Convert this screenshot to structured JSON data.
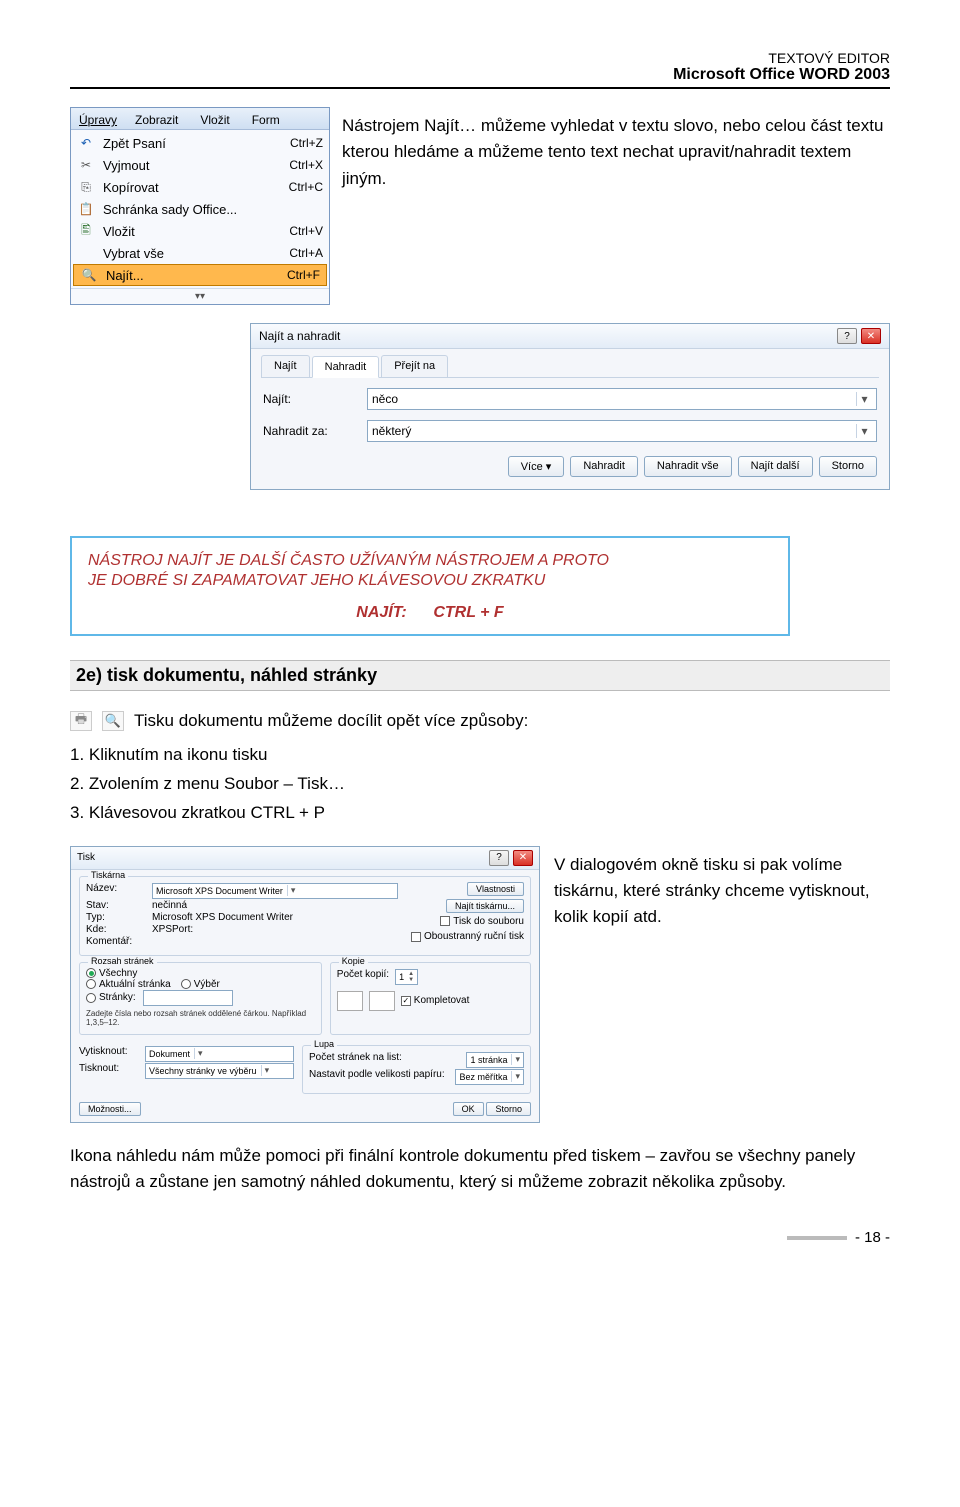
{
  "header": {
    "line1": "TEXTOVÝ EDITOR",
    "line2": "Microsoft Office WORD 2003"
  },
  "menu": {
    "tabs": [
      "Úpravy",
      "Zobrazit",
      "Vložit",
      "Form"
    ],
    "items": [
      {
        "icon": "↶",
        "iconClass": "icon-arrow",
        "label": "Zpět Psaní",
        "shortcut": "Ctrl+Z"
      },
      {
        "icon": "✂",
        "iconClass": "icon-scissors",
        "label": "Vyjmout",
        "shortcut": "Ctrl+X"
      },
      {
        "icon": "⎘",
        "iconClass": "icon-copy",
        "label": "Kopírovat",
        "shortcut": "Ctrl+C"
      },
      {
        "icon": "📋",
        "iconClass": "icon-clip",
        "label": "Schránka sady Office...",
        "shortcut": ""
      },
      {
        "icon": "🖺",
        "iconClass": "icon-paste",
        "label": "Vložit",
        "shortcut": "Ctrl+V"
      },
      {
        "icon": "",
        "iconClass": "",
        "label": "Vybrat vše",
        "shortcut": "Ctrl+A"
      },
      {
        "icon": "🔍",
        "iconClass": "icon-find",
        "label": "Najít...",
        "shortcut": "Ctrl+F",
        "selected": true
      }
    ]
  },
  "para1": "Nástrojem Najít… můžeme vyhledat v textu slovo, nebo celou část textu kterou hledáme a můžeme tento text nechat upravit/nahradit textem jiným.",
  "dialog": {
    "title": "Najít a nahradit",
    "tabs": [
      "Najít",
      "Nahradit",
      "Přejít na"
    ],
    "activeTab": 1,
    "fields": {
      "najit_label": "Najít:",
      "najit_value": "něco",
      "nahradit_label": "Nahradit za:",
      "nahradit_value": "některý"
    },
    "buttons": [
      "Více  ▾",
      "Nahradit",
      "Nahradit vše",
      "Najít další",
      "Storno"
    ]
  },
  "tip": {
    "l1": "NÁSTROJ NAJÍT JE DALŠÍ ČASTO UŽÍVANÝM NÁSTROJEM A PROTO",
    "l2": "JE DOBRÉ SI ZAPAMATOVAT JEHO KLÁVESOVOU ZKRATKU",
    "shortcut_label": "NAJÍT:",
    "shortcut_value": "CTRL + F"
  },
  "section2": {
    "heading": "2e) tisk dokumentu, náhled stránky",
    "intro": "Tisku dokumentu můžeme docílit opět více způsoby:",
    "items": [
      "1. Kliknutím na ikonu tisku",
      "2. Zvolením z menu Soubor – Tisk…",
      "3. Klávesovou zkratkou CTRL + P"
    ]
  },
  "printdlg": {
    "title": "Tisk",
    "printer": {
      "box": "Tiskárna",
      "nazev_l": "Název:",
      "nazev_v": "Microsoft XPS Document Writer",
      "stav_l": "Stav:",
      "stav_v": "nečinná",
      "typ_l": "Typ:",
      "typ_v": "Microsoft XPS Document Writer",
      "kde_l": "Kde:",
      "kde_v": "XPSPort:",
      "komentar_l": "Komentář:",
      "btn_vlastnosti": "Vlastnosti",
      "btn_najit": "Najít tiskárnu...",
      "chk_soubor": "Tisk do souboru",
      "chk_obou": "Oboustranný ruční tisk"
    },
    "range": {
      "box": "Rozsah stránek",
      "vsechny": "Všechny",
      "aktualni": "Aktuální stránka",
      "vyber": "Výběr",
      "stranky": "Stránky:",
      "hint": "Zadejte čísla nebo rozsah stránek oddělené čárkou. Například 1,3,5–12."
    },
    "kopie": {
      "box": "Kopie",
      "pocet_l": "Počet kopií:",
      "pocet_v": "1",
      "komplet": "Kompletovat"
    },
    "bottom": {
      "vytisknout_l": "Vytisknout:",
      "vytisknout_v": "Dokument",
      "tisknout_l": "Tisknout:",
      "tisknout_v": "Všechny stránky ve výběru",
      "lupa": "Lupa",
      "ps_list_l": "Počet stránek na list:",
      "ps_list_v": "1 stránka",
      "velikost_l": "Nastavit podle velikosti papíru:",
      "velikost_v": "Bez měřítka",
      "moznosti": "Možnosti...",
      "ok": "OK",
      "storno": "Storno"
    }
  },
  "side_right": "V dialogovém okně tisku si pak volíme tiskárnu, které stránky chceme vytisknout, kolik kopií atd.",
  "para_final": "Ikona náhledu nám může pomoci při finální kontrole dokumentu před tiskem – zavřou se všechny panely nástrojů a zůstane jen samotný náhled dokumentu, který si můžeme zobrazit několika způsoby.",
  "pagenum": "- 18 -"
}
